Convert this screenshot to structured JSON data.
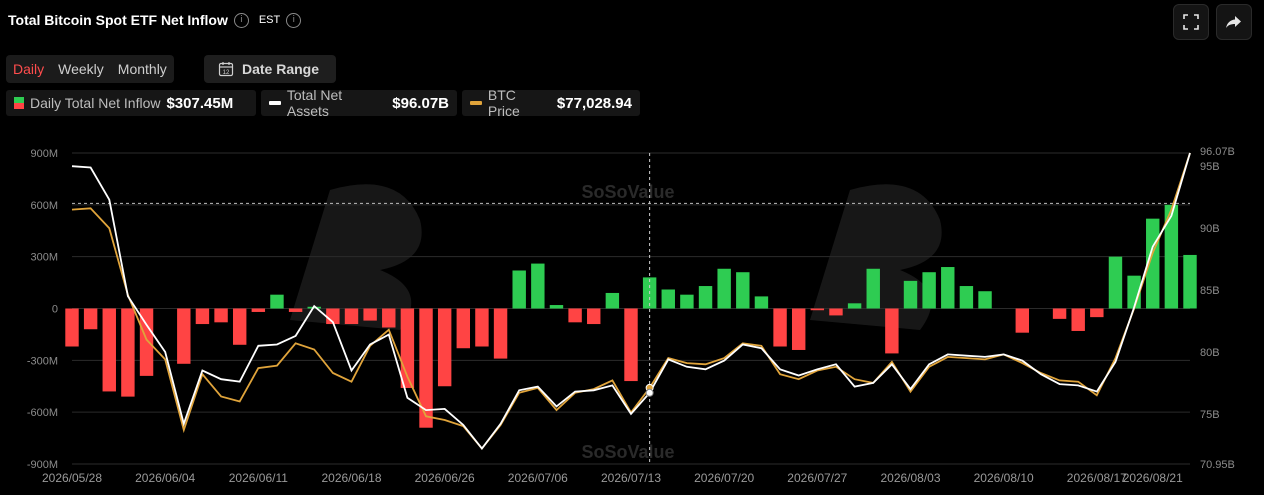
{
  "header": {
    "title": "Total Bitcoin Spot ETF Net Inflow",
    "timezone": "EST",
    "info_icon": "info-icon"
  },
  "toolbar": {
    "fullscreen_icon": "fullscreen-icon",
    "share_icon": "share-icon"
  },
  "tabs": [
    {
      "label": "Daily",
      "active": true
    },
    {
      "label": "Weekly",
      "active": false
    },
    {
      "label": "Monthly",
      "active": false
    }
  ],
  "date_range": {
    "label": "Date Range",
    "icon": "calendar-icon"
  },
  "legend": [
    {
      "name": "Daily Total Net Inflow",
      "value": "$307.45M",
      "color_pos": "#2ecc52",
      "color_neg": "#ff4444"
    },
    {
      "name": "Total Net Assets",
      "value": "$96.07B",
      "color": "#ffffff"
    },
    {
      "name": "BTC Price",
      "value": "$77,028.94",
      "color": "#e0a43b"
    }
  ],
  "watermark": "SoSoValue",
  "chart_data": {
    "type": "bar",
    "colors": {
      "positive": "#2ecc52",
      "negative": "#ff4444",
      "assets": "#ffffff",
      "price": "#e0a43b"
    },
    "left_axis": {
      "ticks": [
        900,
        600,
        300,
        0,
        -300,
        -600,
        -900
      ],
      "labels": [
        "900M",
        "600M",
        "300M",
        "0",
        "-300M",
        "-600M",
        "-900M"
      ],
      "ylim": [
        -900,
        900
      ]
    },
    "right_axis": {
      "ticks": [
        95,
        90,
        85,
        80,
        75,
        70.95
      ],
      "labels": [
        "95B",
        "90B",
        "85B",
        "80B",
        "75B",
        "70.95B"
      ],
      "ylim": [
        70.95,
        96.07
      ],
      "top_label": "96.07B"
    },
    "x_tick_labels": [
      "2026/05/28",
      "2026/06/04",
      "2026/06/11",
      "2026/06/18",
      "2026/06/26",
      "2026/07/06",
      "2026/07/13",
      "2026/07/20",
      "2026/07/27",
      "2026/08/03",
      "2026/08/10",
      "2026/08/17",
      "2026/08/21"
    ],
    "x_tick_positions": [
      0,
      5,
      10,
      15,
      20,
      25,
      30,
      35,
      40,
      45,
      50,
      55,
      58
    ],
    "inflow_values": [
      -220,
      -120,
      -480,
      -510,
      -390,
      0,
      -320,
      -90,
      -80,
      -210,
      -20,
      80,
      -20,
      10,
      -90,
      -90,
      -70,
      -110,
      -460,
      -690,
      -450,
      -230,
      -220,
      -290,
      220,
      260,
      20,
      -80,
      -90,
      90,
      -420,
      180,
      110,
      80,
      130,
      230,
      210,
      70,
      -220,
      -240,
      -10,
      -40,
      30,
      230,
      -260,
      160,
      210,
      240,
      130,
      100,
      0,
      -140,
      0,
      -60,
      -130,
      -50,
      300,
      190,
      520,
      600,
      310
    ],
    "assets_values": [
      95.0,
      94.9,
      92.3,
      84.5,
      82.2,
      80.0,
      74.2,
      78.5,
      77.8,
      77.6,
      80.5,
      80.6,
      81.3,
      83.7,
      82.4,
      78.5,
      80.6,
      81.4,
      76.3,
      75.3,
      75.4,
      74.1,
      72.2,
      74.2,
      76.9,
      77.2,
      75.6,
      76.8,
      76.9,
      77.3,
      75.0,
      76.7,
      79.4,
      78.8,
      78.6,
      79.3,
      80.6,
      80.3,
      78.6,
      78.1,
      78.6,
      79.0,
      77.2,
      77.5,
      79.0,
      77.0,
      79.0,
      79.8,
      79.7,
      79.6,
      79.8,
      79.3,
      78.2,
      77.4,
      77.3,
      76.8,
      79.2,
      83.6,
      88.5,
      91.0,
      96.07
    ],
    "price_values": [
      91.5,
      91.6,
      90.0,
      84.6,
      81.0,
      79.4,
      73.7,
      78.2,
      76.4,
      76.0,
      78.7,
      78.9,
      80.7,
      80.2,
      78.3,
      77.6,
      80.5,
      81.8,
      78.0,
      74.8,
      74.5,
      74.0,
      72.2,
      74.1,
      76.7,
      77.1,
      75.3,
      76.7,
      77.0,
      77.7,
      75.1,
      77.1,
      79.5,
      79.1,
      79.0,
      79.5,
      80.7,
      80.5,
      78.2,
      77.8,
      78.5,
      78.8,
      77.8,
      77.5,
      79.2,
      76.8,
      78.8,
      79.6,
      79.5,
      79.4,
      79.8,
      79.1,
      78.3,
      77.7,
      77.6,
      76.5,
      79.5,
      83.5,
      88.0,
      91.5,
      96.07
    ],
    "crosshair_index": 31
  }
}
